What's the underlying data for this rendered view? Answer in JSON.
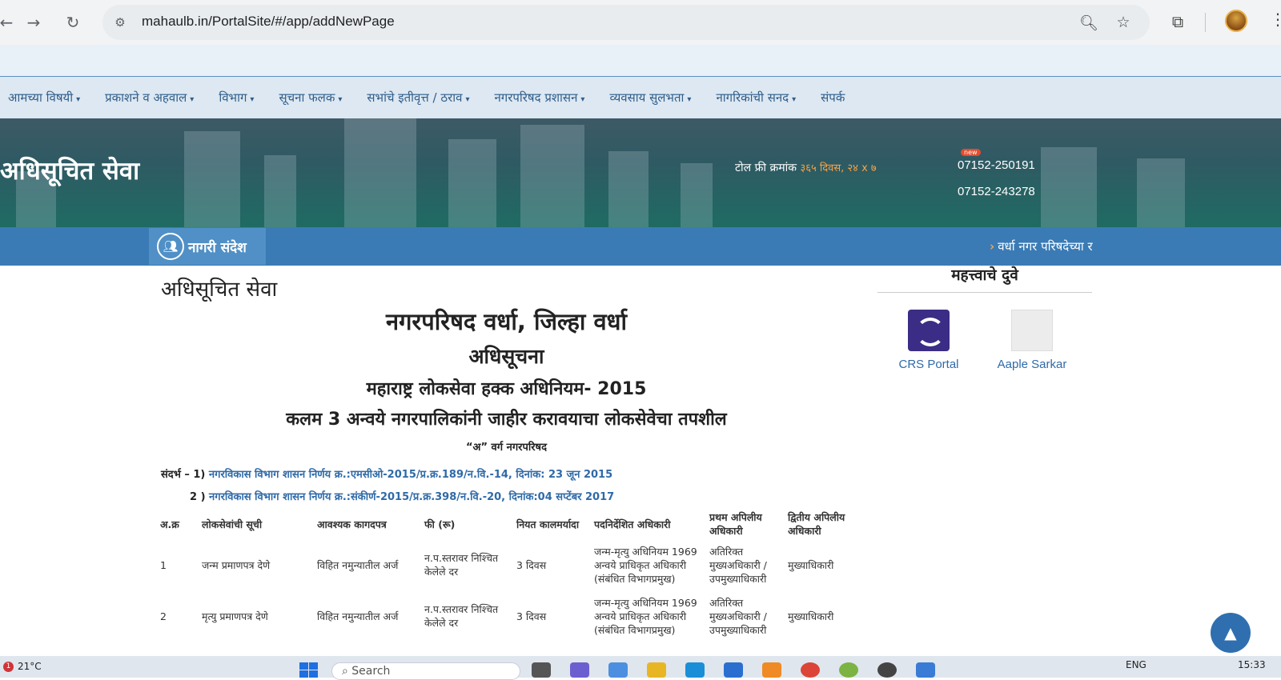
{
  "browser": {
    "url": "mahaulb.in/PortalSite/#/app/addNewPage",
    "icons": [
      "back-arrow",
      "forward-arrow",
      "reload",
      "site-info",
      "zoom",
      "bookmark-star",
      "extensions",
      "profile-avatar",
      "menu"
    ]
  },
  "mainmenu": {
    "items": [
      {
        "label": "आमच्या विषयी"
      },
      {
        "label": "प्रकाशने व अहवाल"
      },
      {
        "label": "विभाग"
      },
      {
        "label": "सूचना फलक"
      },
      {
        "label": "सभांचे इतीवृत्त / ठराव"
      },
      {
        "label": "नगरपरिषद प्रशासन"
      },
      {
        "label": "व्यवसाय सुलभता"
      },
      {
        "label": "नागरिकांची सनद"
      },
      {
        "label": "संपर्क"
      }
    ],
    "caret": "▾"
  },
  "banner": {
    "title": "अधिसूचित सेवा",
    "tollfree_label": "टोल फ्री क्रमांक",
    "tollfree_hours": "३६५ दिवस, २४ x ७",
    "new_badge": "new",
    "phone1": "07152-250191",
    "phone2": "07152-243278"
  },
  "newsbar": {
    "label": "नागरी संदेश",
    "ticker": "वर्धा नगर परिषदेच्या र"
  },
  "content": {
    "heading": "अधिसूचित सेवा",
    "line1": "नगरपरिषद वर्धा, जिल्हा वर्धा",
    "line2": "अधिसूचना",
    "line3": "महाराष्ट्र लोकसेवा हक्क अधिनियम- 2015",
    "line4": "कलम 3 अन्वये नगरपालिकांनी जाहीर करावयाचा लोकसेवेचा तपशील",
    "line5": "“अ” वर्ग नगरपरिषद",
    "ref1_prefix": "संदर्भ – 1)",
    "ref1_link": "नगरविकास विभाग शासन निर्णय क्र.:एमसीओ-2015/प्र.क्र.189/न.वि.-14, दिनांक: 23 जून 2015",
    "ref2_prefix": "2 )",
    "ref2_link": "नगरविकास विभाग शासन निर्णय क्र.:संकीर्ण-2015/प्र.क्र.398/न.वि.-20, दिनांक:04 सप्टेंबर 2017"
  },
  "table": {
    "headers": [
      "अ.क्र",
      "लोकसेवांची सूची",
      "आवश्यक कागदपत्र",
      "फी (रू)",
      "नियत कालमर्यादा",
      "पदनिर्देशित अधिकारी",
      "प्रथम अपिलीय अधिकारी",
      "द्वितीय अपिलीय अधिकारी"
    ],
    "rows": [
      [
        "1",
        "जन्म प्रमाणपत्र  देणे",
        "विहित नमुन्यातील अर्ज",
        "न.प.स्तरावर निश्चित केलेले दर",
        "3 दिवस",
        "जन्म-मृत्यु अधिनियम 1969 अन्वये प्राधिकृत अधिकारी (संबंधित विभागप्रमुख)",
        "अतिरिक्त मुख्यअधिकारी / उपमुख्याधिकारी",
        "मुख्याधिकारी"
      ],
      [
        "2",
        "मृत्यु प्रमाणपत्र  देणे",
        "विहित नमुन्यातील अर्ज",
        "न.प.स्तरावर निश्चित केलेले दर",
        "3 दिवस",
        "जन्म-मृत्यु अधिनियम 1969 अन्वये प्राधिकृत अधिकारी (संबंधित विभागप्रमुख)",
        "अतिरिक्त मुख्यअधिकारी / उपमुख्याधिकारी",
        "मुख्याधिकारी"
      ]
    ]
  },
  "sidebar": {
    "title": "महत्त्वाचे दुवे",
    "links": [
      {
        "label": "CRS Portal"
      },
      {
        "label": "Aaple Sarkar"
      }
    ]
  },
  "taskbar": {
    "weather_badge": "1",
    "temperature": "21°C",
    "search_placeholder": "Search",
    "language": "ENG",
    "time": "15:33"
  }
}
